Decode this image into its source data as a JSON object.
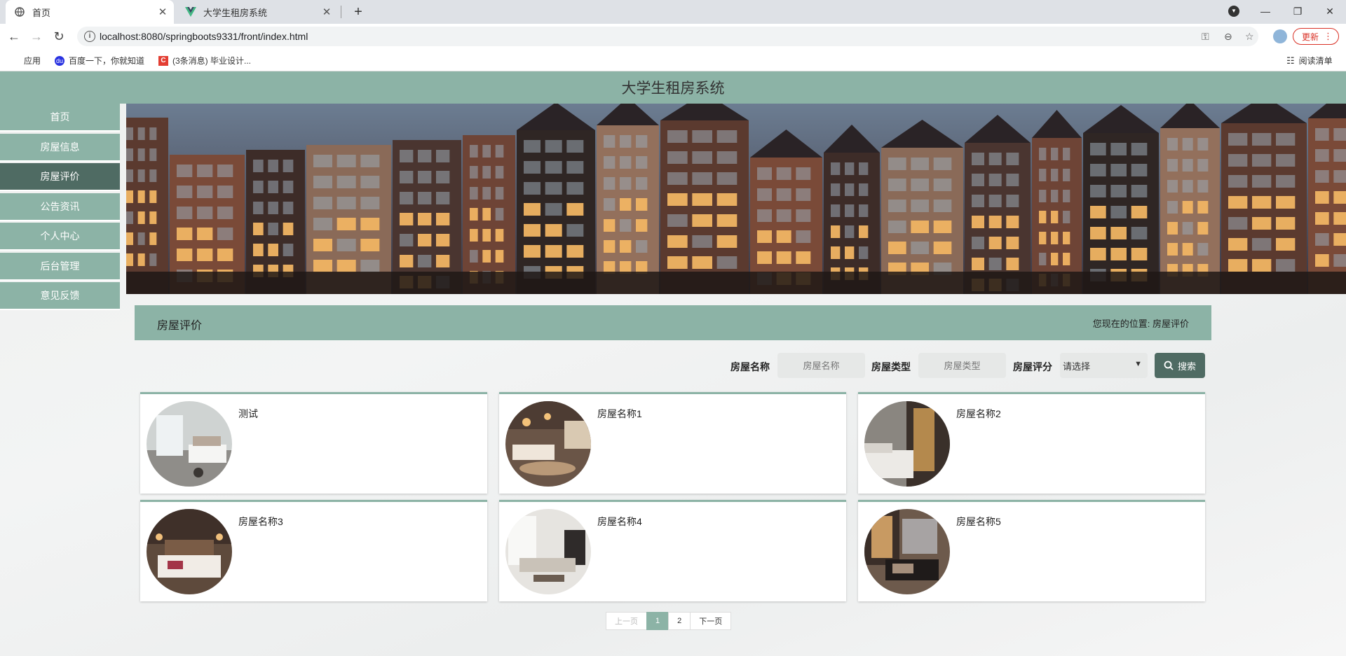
{
  "browser": {
    "tabs": [
      {
        "title": "首页",
        "active": true
      },
      {
        "title": "大学生租房系统",
        "active": false
      }
    ],
    "url": "localhost:8080/springboots9331/front/index.html",
    "update_label": "更新",
    "bookmarks": [
      "应用",
      "百度一下，你就知道",
      "(3条消息) 毕业设计..."
    ],
    "reading_list": "阅读清单"
  },
  "site": {
    "title": "大学生租房系统",
    "nav": [
      {
        "label": "首页",
        "active": false
      },
      {
        "label": "房屋信息",
        "active": false
      },
      {
        "label": "房屋评价",
        "active": true
      },
      {
        "label": "公告资讯",
        "active": false
      },
      {
        "label": "个人中心",
        "active": false
      },
      {
        "label": "后台管理",
        "active": false
      },
      {
        "label": "意见反馈",
        "active": false
      }
    ]
  },
  "section": {
    "title": "房屋评价",
    "location_label": "您现在的位置:",
    "location_value": "房屋评价"
  },
  "filters": {
    "name_label": "房屋名称",
    "name_placeholder": "房屋名称",
    "type_label": "房屋类型",
    "type_placeholder": "房屋类型",
    "score_label": "房屋评分",
    "score_value": "请选择",
    "search_label": "搜索"
  },
  "cards": [
    {
      "name": "测试"
    },
    {
      "name": "房屋名称1"
    },
    {
      "name": "房屋名称2"
    },
    {
      "name": "房屋名称3"
    },
    {
      "name": "房屋名称4"
    },
    {
      "name": "房屋名称5"
    }
  ],
  "pagination": {
    "prev": "上一页",
    "pages": [
      "1",
      "2"
    ],
    "current": "1",
    "next": "下一页"
  },
  "colors": {
    "primary": "#8cb3a6",
    "active": "#4f6b63"
  }
}
